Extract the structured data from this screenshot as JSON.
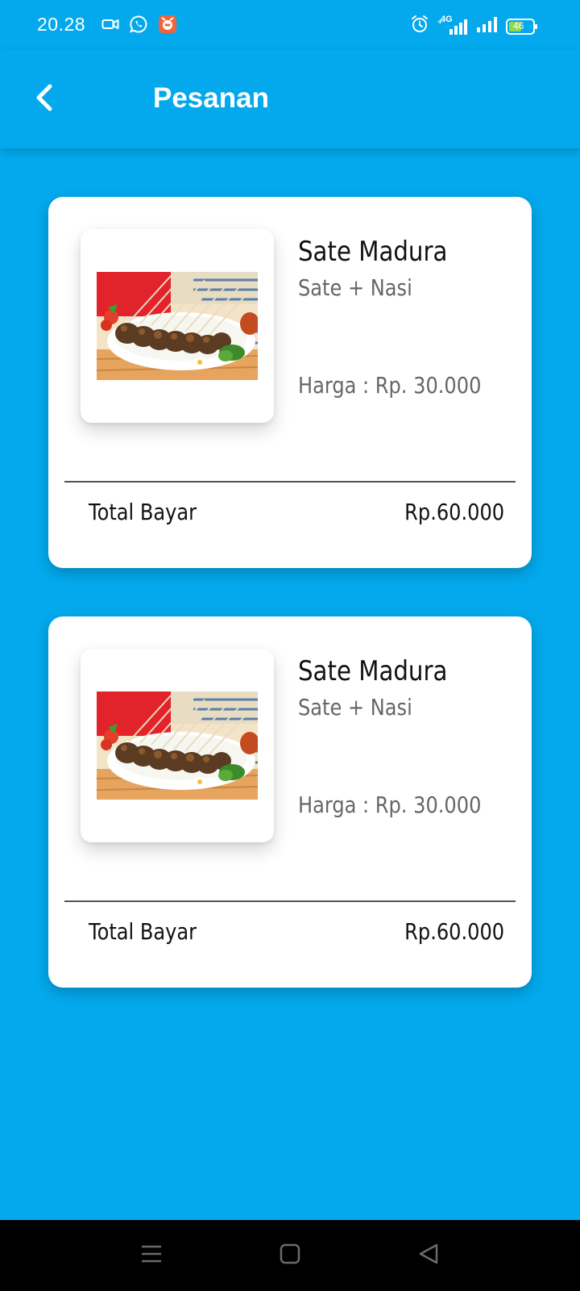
{
  "status_bar": {
    "time": "20.28",
    "battery_level": "46",
    "network_label": "4G",
    "left_icons": [
      "video-camera-icon",
      "whatsapp-icon",
      "app-notification-icon"
    ],
    "right_icons": [
      "alarm-icon",
      "signal-4g-icon",
      "signal-icon",
      "battery-icon"
    ]
  },
  "app_bar": {
    "title": "Pesanan",
    "back_icon": "chevron-left-icon",
    "background_color": "#03A9EC"
  },
  "orders": [
    {
      "name": "Sate Madura",
      "description": "Sate + Nasi",
      "price": "Harga : Rp. 30.000",
      "total_label": "Total Bayar",
      "total_value": "Rp.60.000",
      "image_icon": "sate-food-image"
    },
    {
      "name": "Sate Madura",
      "description": "Sate + Nasi",
      "price": "Harga : Rp. 30.000",
      "total_label": "Total Bayar",
      "total_value": "Rp.60.000",
      "image_icon": "sate-food-image"
    }
  ],
  "nav_bar": {
    "icons": [
      "menu-icon",
      "home-icon",
      "back-triangle-icon"
    ]
  }
}
